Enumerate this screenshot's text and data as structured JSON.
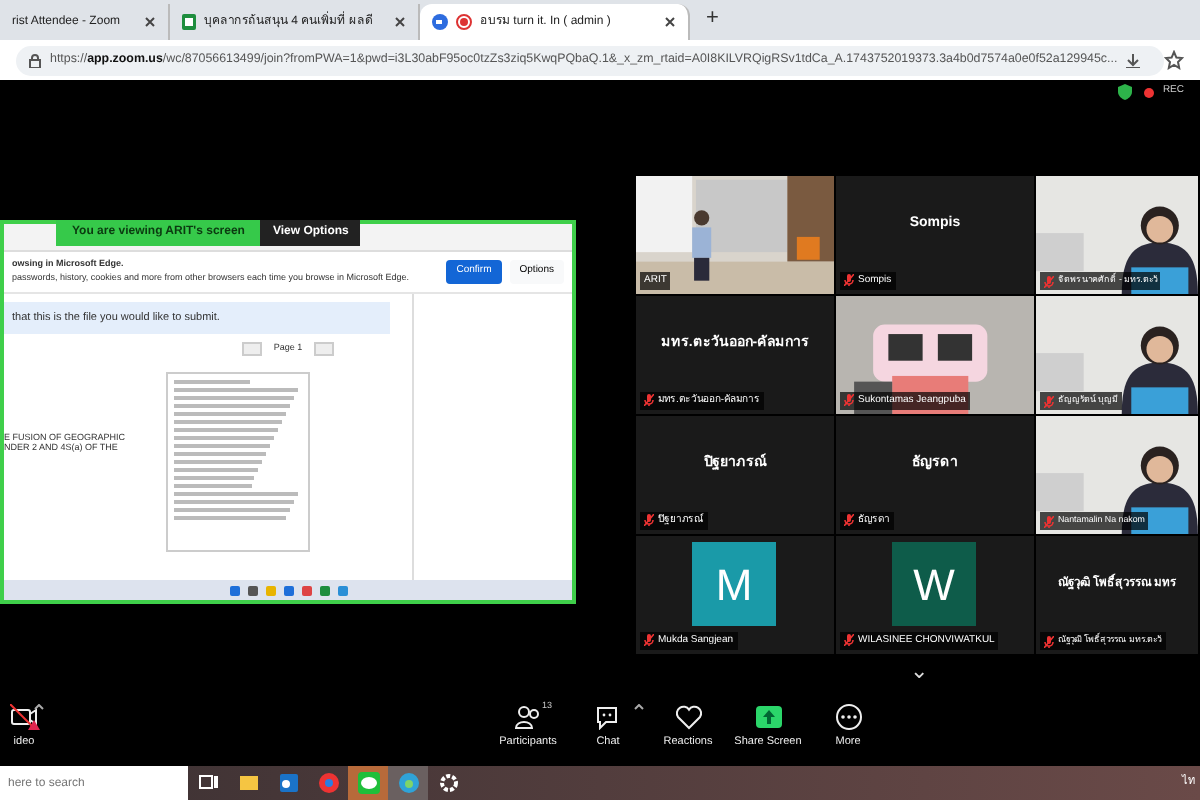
{
  "browser": {
    "tabs": [
      {
        "title": "rist Attendee - Zoom",
        "selected": false
      },
      {
        "title": "บุคลากรถ้นสนุน 4 คนเพิ่มที่ ผลดี",
        "selected": false
      },
      {
        "title": "อบรม turn it. In ( admin )",
        "selected": true
      }
    ],
    "new_tab": "+",
    "url": "https://**app.zoom.us**/wc/87056613499/join?fromPWA=1&pwd=i3L30abF95oc0tzZs3ziq5KwqPQbaQ.1&_x_zm_rtaid=A0I8KILVRQigRSv1tdCa_A.1743752019373.3a4b0d7574a0e0f52a129945c..."
  },
  "recording": {
    "label": "REC",
    "on": true
  },
  "share": {
    "banner": "You are viewing  ARIT's screen",
    "view_options": "View Options",
    "notice": "owsing in Microsoft Edge.",
    "notice_detail": "passwords, history, cookies and more from other browsers each time you browse in Microsoft Edge.",
    "confirm": "Confirm",
    "options": "Options",
    "message": "that this is the file you would like to submit.",
    "page": "Page 1",
    "doc_text": "E FUSION OF GEOGRAPHIC\nNDER 2 AND 4S(a) OF THE"
  },
  "gallery": [
    {
      "kind": "video",
      "label": "ARIT",
      "muted": false
    },
    {
      "kind": "name",
      "display_name": "Sompis",
      "label": "Sompis",
      "muted": true
    },
    {
      "kind": "video",
      "label": "จิตพร นาคศักดิ์ - มทร.ตะวั",
      "muted": true
    },
    {
      "kind": "name",
      "display_name": "มทร.ตะวันออก-คัลมการ",
      "label": "มทร.ตะวันออก-คัลมการ",
      "muted": true
    },
    {
      "kind": "video",
      "label": "Sukontamas Jeangpuba",
      "muted": true
    },
    {
      "kind": "video",
      "label": "ธัญญรัตน์ บุญมี",
      "muted": true
    },
    {
      "kind": "name",
      "display_name": "ปิฐยาภรณ์",
      "label": "ปิฐยาภรณ์",
      "muted": true
    },
    {
      "kind": "name",
      "display_name": "ธัญรดา",
      "label": "ธัญรดา",
      "muted": true
    },
    {
      "kind": "video",
      "label": "Nantamalin Na nakom",
      "muted": true
    },
    {
      "kind": "avatar",
      "initial": "M",
      "color": "#1a9aa8",
      "label": "Mukda Sangjean",
      "muted": true
    },
    {
      "kind": "avatar",
      "initial": "W",
      "color": "#0e5c4a",
      "label": "WILASINEE CHONVIWATKUL",
      "muted": true
    },
    {
      "kind": "name",
      "display_name": "ณัฐวุฒิ โพธิ์สุวรรณ มทร",
      "label": "ณัฐวุฒิ โพธิ์สุวรรณ มทร.ตะวั",
      "muted": true
    }
  ],
  "gallery_next": "⌄",
  "toolbar": [
    {
      "label": "ideo",
      "caret": true
    },
    {
      "label": "Participants",
      "count": "13",
      "caret": false
    },
    {
      "label": "Chat",
      "caret": true
    },
    {
      "label": "Reactions",
      "caret": false
    },
    {
      "label": "Share Screen",
      "caret": false
    },
    {
      "label": "More",
      "caret": false
    }
  ],
  "taskbar": {
    "search_placeholder": "here to search",
    "language": "ไท"
  }
}
